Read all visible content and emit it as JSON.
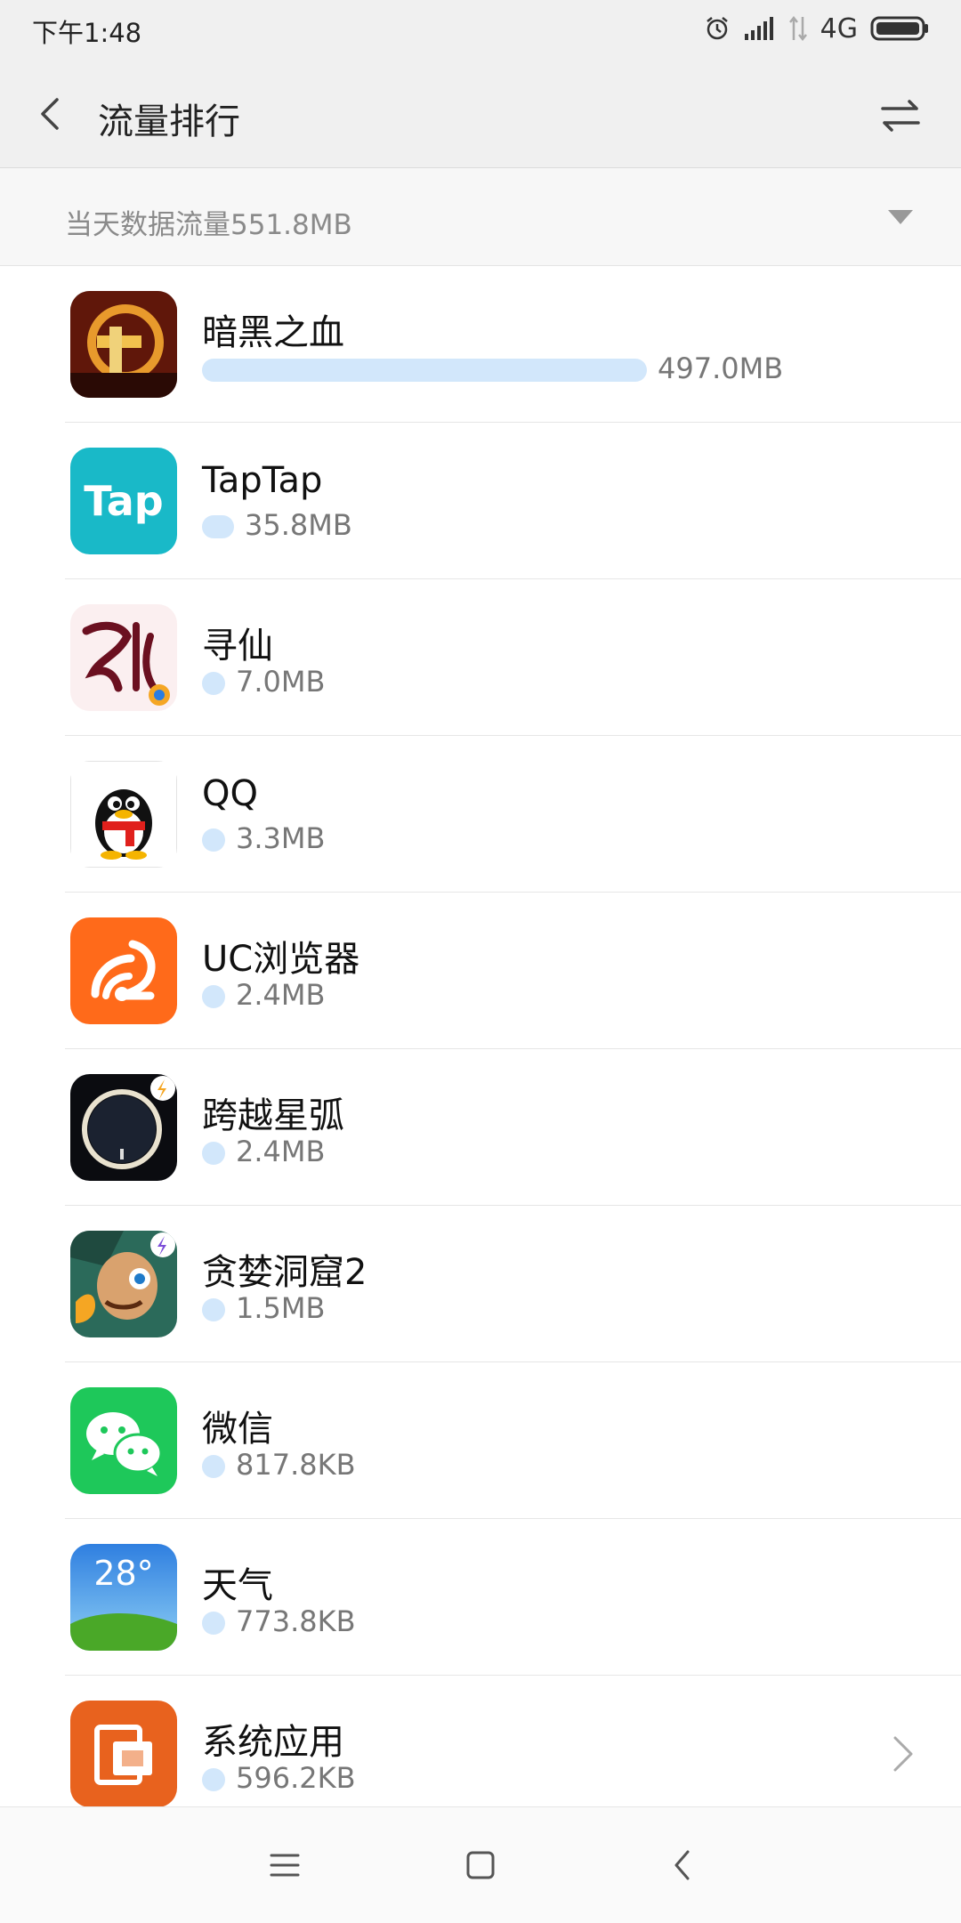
{
  "status_bar": {
    "time": "下午1:48",
    "network": "4G",
    "icons": [
      "alarm-icon",
      "signal-icon",
      "data-arrows-icon",
      "battery-icon"
    ]
  },
  "app_bar": {
    "title": "流量排行",
    "back_icon": "chevron-left-icon",
    "action_icon": "swap-arrows-icon"
  },
  "summary": {
    "text": "当天数据流量551.8MB",
    "dropdown_icon": "caret-down-icon"
  },
  "colors": {
    "usage_bar": "#d2e7fb",
    "header_bg": "#f0f0f0",
    "divider": "#e6e6e6"
  },
  "apps": [
    {
      "name": "暗黑之血",
      "usage": "497.0MB",
      "usage_mb": 497.0,
      "icon": "dark-blood-app-icon"
    },
    {
      "name": "TapTap",
      "usage": "35.8MB",
      "usage_mb": 35.8,
      "icon": "taptap-app-icon"
    },
    {
      "name": "寻仙",
      "usage": "7.0MB",
      "usage_mb": 7.0,
      "icon": "xunxian-app-icon"
    },
    {
      "name": "QQ",
      "usage": "3.3MB",
      "usage_mb": 3.3,
      "icon": "qq-penguin-icon"
    },
    {
      "name": "UC浏览器",
      "usage": "2.4MB",
      "usage_mb": 2.4,
      "icon": "uc-browser-squirrel-icon"
    },
    {
      "name": "跨越星弧",
      "usage": "2.4MB",
      "usage_mb": 2.4,
      "icon": "star-arc-app-icon"
    },
    {
      "name": "贪婪洞窟2",
      "usage": "1.5MB",
      "usage_mb": 1.5,
      "icon": "greedy-cave-app-icon"
    },
    {
      "name": "微信",
      "usage": "817.8KB",
      "usage_mb": 0.8178,
      "icon": "wechat-icon"
    },
    {
      "name": "天气",
      "usage": "773.8KB",
      "usage_mb": 0.7738,
      "icon": "weather-icon",
      "icon_text": "28°"
    },
    {
      "name": "系统应用",
      "usage": "596.2KB",
      "usage_mb": 0.5962,
      "icon": "system-apps-icon"
    }
  ],
  "nav_bar": {
    "items": [
      "menu-icon",
      "home-icon",
      "back-icon"
    ]
  }
}
